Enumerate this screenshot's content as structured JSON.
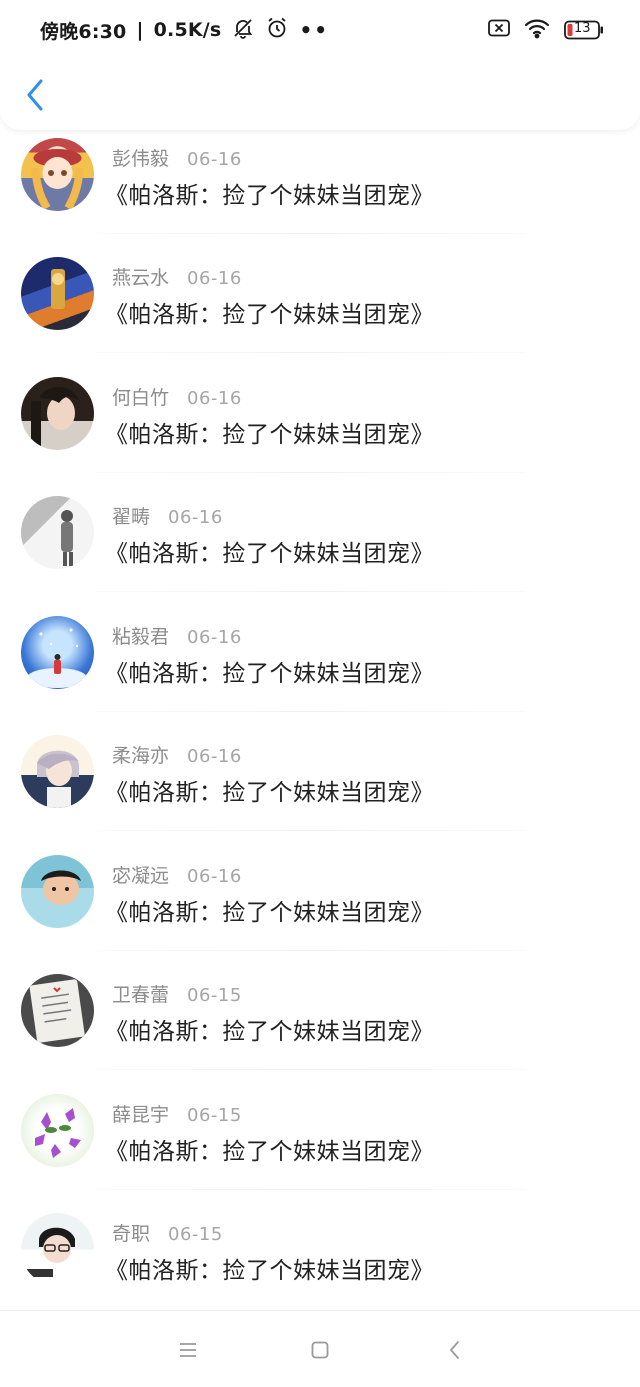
{
  "status_bar": {
    "time": "傍晚6:30",
    "network_speed": "0.5K/s",
    "battery_level": "13",
    "icons": [
      "mute-bell-icon",
      "alarm-icon",
      "more-dots-icon",
      "sim-blocked-icon",
      "wifi-icon",
      "battery-icon"
    ]
  },
  "header": {
    "back_icon": "chevron-left-icon",
    "accent_color": "#2f8ff0"
  },
  "list": [
    {
      "name": "彭伟毅",
      "date": "06-16",
      "title": "《帕洛斯：捡了个妹妹当团宠》"
    },
    {
      "name": "燕云水",
      "date": "06-16",
      "title": "《帕洛斯：捡了个妹妹当团宠》"
    },
    {
      "name": "何白竹",
      "date": "06-16",
      "title": "《帕洛斯：捡了个妹妹当团宠》"
    },
    {
      "name": "翟畴",
      "date": "06-16",
      "title": "《帕洛斯：捡了个妹妹当团宠》"
    },
    {
      "name": "粘毅君",
      "date": "06-16",
      "title": "《帕洛斯：捡了个妹妹当团宠》"
    },
    {
      "name": "柔海亦",
      "date": "06-16",
      "title": "《帕洛斯：捡了个妹妹当团宠》"
    },
    {
      "name": "宓凝远",
      "date": "06-16",
      "title": "《帕洛斯：捡了个妹妹当团宠》"
    },
    {
      "name": "卫春蕾",
      "date": "06-15",
      "title": "《帕洛斯：捡了个妹妹当团宠》"
    },
    {
      "name": "薛昆宇",
      "date": "06-15",
      "title": "《帕洛斯：捡了个妹妹当团宠》"
    },
    {
      "name": "奇职",
      "date": "06-15",
      "title": "《帕洛斯：捡了个妹妹当团宠》"
    }
  ],
  "nav_bar": {
    "icons": [
      "menu-icon",
      "home-icon",
      "back-icon"
    ]
  }
}
